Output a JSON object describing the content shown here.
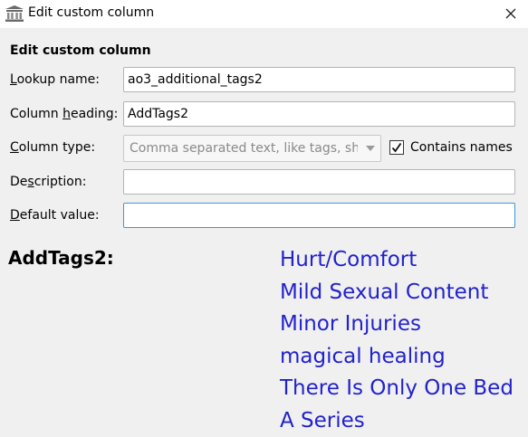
{
  "window": {
    "title": "Edit custom column",
    "close_glyph": "✕"
  },
  "form": {
    "heading": "Edit custom column",
    "lookup_name": {
      "label_underlined": "L",
      "label_rest": "ookup name:",
      "value": "ao3_additional_tags2"
    },
    "column_heading": {
      "label_before": "Column ",
      "label_underlined": "h",
      "label_rest": "eading:",
      "value": "AddTags2"
    },
    "column_type": {
      "label_before": "",
      "label_underlined": "C",
      "label_rest": "olumn type:",
      "selected": "Comma separated text, like tags, shown in the Tag browser",
      "contains_names_label": "Contains names",
      "contains_names_checked": true
    },
    "description": {
      "label_before": "De",
      "label_underlined": "s",
      "label_rest": "cription:",
      "value": ""
    },
    "default_value": {
      "label_before": "",
      "label_underlined": "D",
      "label_rest": "efault value:",
      "value": ""
    }
  },
  "preview": {
    "heading": "AddTags2:",
    "tags": [
      "Hurt/Comfort",
      "Mild Sexual Content",
      "Minor Injuries",
      "magical healing",
      "There Is Only One Bed",
      "A Series"
    ],
    "tag_color": "#2222cc"
  },
  "icons": {
    "app": "library-columns-icon",
    "close": "close-icon",
    "dropdown": "chevron-down-icon",
    "check": "checkmark-icon"
  }
}
